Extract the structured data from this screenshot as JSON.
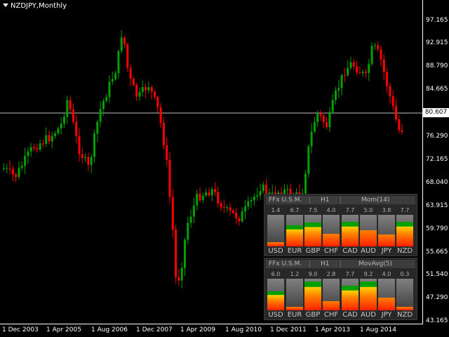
{
  "window": {
    "title": "NZDJPY,Monthly"
  },
  "price_axis": {
    "labels": [
      "97.165",
      "92.915",
      "88.790",
      "84.665",
      "80.607",
      "76.290",
      "72.165",
      "68.040",
      "63.915",
      "59.790",
      "55.665",
      "51.540",
      "47.290",
      "43.165"
    ],
    "current_price": "80.607"
  },
  "time_axis": {
    "labels": [
      "1 Dec 2003",
      "1 Apr 2005",
      "1 Aug 2006",
      "1 Dec 2007",
      "1 Apr 2009",
      "1 Aug 2010",
      "1 Dec 2011",
      "1 Apr 2013",
      "1 Aug 2014"
    ]
  },
  "colors": {
    "bull": "#00a000",
    "bear": "#ff0000",
    "background": "#000000",
    "current_line": "#c0c0c0"
  },
  "panel_mom": {
    "title": "FFx U.S.M.",
    "timeframe": "H1",
    "indicator": "Mom(14)",
    "currencies": [
      "USD",
      "EUR",
      "GBP",
      "CHF",
      "CAD",
      "AUD",
      "JPY",
      "NZD"
    ],
    "values": [
      "1.4",
      "6.7",
      "7.5",
      "4.0",
      "7.7",
      "5.0",
      "3.8",
      "7.7"
    ]
  },
  "panel_ma": {
    "title": "FFx U.S.M.",
    "timeframe": "H1",
    "indicator": "MovAvg(5)",
    "currencies": [
      "USD",
      "EUR",
      "GBP",
      "CHF",
      "CAD",
      "AUD",
      "JPY",
      "NZD"
    ],
    "values": [
      "6.0",
      "1.2",
      "9.0",
      "2.8",
      "7.7",
      "9.2",
      "4.0",
      "0.3"
    ]
  }
}
